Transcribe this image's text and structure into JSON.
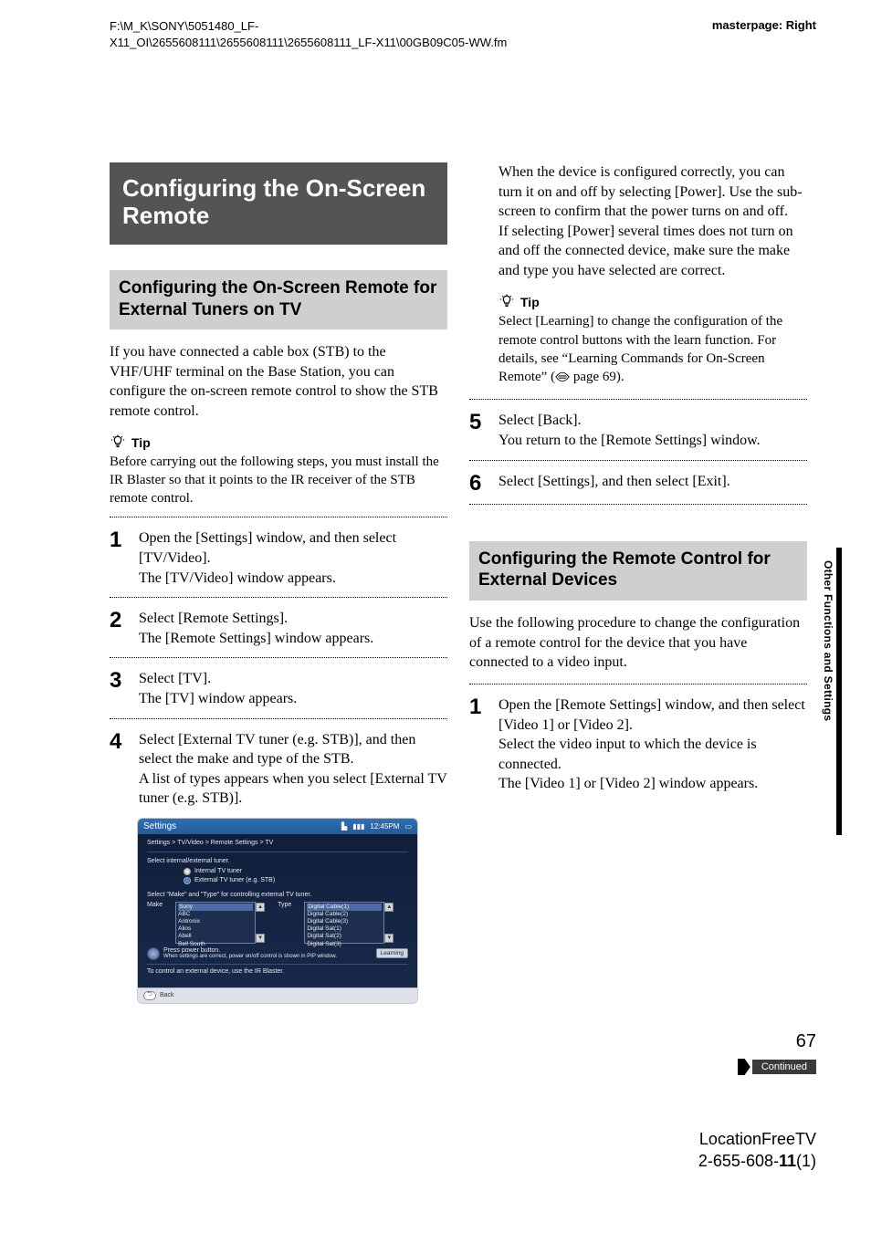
{
  "header": {
    "path_line1": "F:\\M_K\\SONY\\5051480_LF-",
    "path_line2": "X11_OI\\2655608111\\2655608111\\2655608111_LF-X11\\00GB09C05-WW.fm",
    "masterpage": "masterpage: Right"
  },
  "left": {
    "main_title": "Configuring the On-Screen Remote",
    "sub1": "Configuring the On-Screen Remote for External Tuners on TV",
    "intro": "If you have connected a cable box (STB) to the VHF/UHF terminal on the Base Station, you can configure the on-screen remote control to show the STB remote control.",
    "tip_label": "Tip",
    "tip_text": "Before carrying out the following steps, you must install the IR Blaster so that it points to the IR receiver of the STB remote control.",
    "steps": {
      "s1a": "Open the [Settings] window, and then select [TV/Video].",
      "s1b": "The [TV/Video] window appears.",
      "s2a": "Select [Remote Settings].",
      "s2b": "The [Remote Settings] window appears.",
      "s3a": "Select [TV].",
      "s3b": "The [TV] window appears.",
      "s4a": "Select [External TV tuner (e.g. STB)], and then select the make and type of the STB.",
      "s4b": "A list of types appears when you select [External TV tuner (e.g. STB)]."
    },
    "screenshot": {
      "title": "Settings",
      "time": "12:45PM",
      "breadcrumb": "Settings > TV/Video > Remote Settings > TV",
      "select_tuner": "Select internal/external tuner.",
      "radio1": "Internal TV tuner",
      "radio2": "External TV tuner (e.g. STB)",
      "select_make_type": "Select \"Make\" and \"Type\" for controlling external TV tuner.",
      "make_label": "Make",
      "type_label": "Type",
      "makes": [
        "Sony",
        "ABC",
        "Antronix",
        "Alios",
        "Abell",
        "Bell South"
      ],
      "types": [
        "Digital Cable(1)",
        "Digital Cable(2)",
        "Digital Cable(3)",
        "Digital Sat(1)",
        "Digital Sat(2)",
        "Digital Sat(3)"
      ],
      "power_line1": "Press power button.",
      "power_line2": "When settings are correct, power on/off control is shown in PIP window.",
      "learning_btn": "Learning",
      "ir_line": "To control an external device, use the IR Blaster.",
      "back": "Back"
    }
  },
  "right": {
    "s4c": "When the device is configured correctly, you can turn it on and off by selecting [Power]. Use the sub-screen to confirm that the power turns on and off.",
    "s4d": "If selecting [Power] several times does not turn on and off the connected device, make sure the make and type you have selected are correct.",
    "tip_label": "Tip",
    "tip_text_a": "Select [Learning] to change the configuration of the remote control buttons with the learn function. For details, see “Learning Commands for On-Screen Remote” (",
    "tip_text_b": " page 69).",
    "s5a": "Select [Back].",
    "s5b": "You return to the [Remote Settings] window.",
    "s6a": "Select [Settings], and then select [Exit].",
    "sub2": "Configuring the Remote Control for External Devices",
    "intro2": "Use the following procedure to change the configuration of a remote control for the device that you have connected to a video input.",
    "r1a": "Open the [Remote Settings] window, and then select [Video 1] or [Video 2].",
    "r1b": "Select the video input to which the device is connected.",
    "r1c": "The [Video 1] or [Video 2] window appears."
  },
  "side_tab": "Other Functions and Settings",
  "page_number": "67",
  "continued": "Continued",
  "footer": {
    "line1": "LocationFreeTV",
    "line2_a": "2-655-608-",
    "line2_b": "11",
    "line2_c": "(1)"
  },
  "nums": {
    "n1": "1",
    "n2": "2",
    "n3": "3",
    "n4": "4",
    "n5": "5",
    "n6": "6"
  }
}
